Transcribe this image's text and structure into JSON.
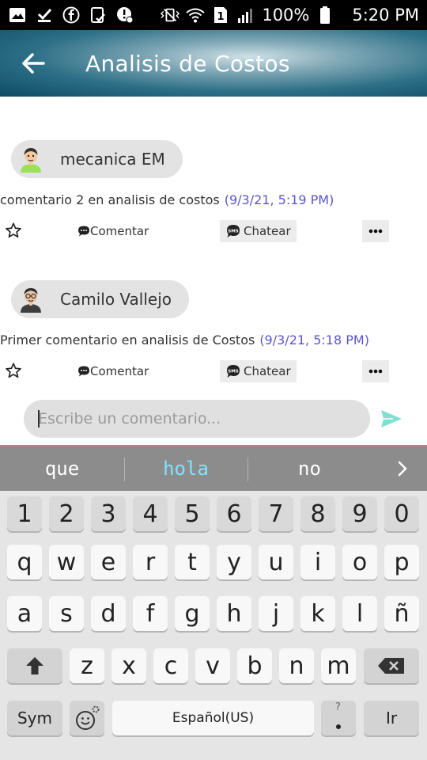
{
  "status_bar": {
    "battery": "100%",
    "time": "5:20 PM",
    "icons": [
      "image-icon",
      "download-done-icon",
      "facebook-icon",
      "clipboard-check-icon",
      "location-alert-icon",
      "vibrate-icon",
      "wifi-icon",
      "sim-1-icon",
      "signal-icon",
      "battery-icon"
    ]
  },
  "header": {
    "title": "Analisis de Costos",
    "back_icon": "arrow-left-icon",
    "background": "#1d5f78"
  },
  "comments": [
    {
      "author": "mecanica EM",
      "text": "comentario 2 en analisis de costos",
      "time": "(9/3/21, 5:19 PM)",
      "comment_label": "Comentar",
      "chat_label": "Chatear"
    },
    {
      "author": "Camilo Vallejo",
      "text": "Primer comentario en analisis de Costos",
      "time": "(9/3/21, 5:18 PM)",
      "comment_label": "Comentar",
      "chat_label": "Chatear"
    }
  ],
  "composer": {
    "placeholder": "Escribe un comentario...",
    "send_icon": "send-icon",
    "accent": "#7fe0d0"
  },
  "keyboard": {
    "suggestions": [
      "que",
      "hola",
      "no"
    ],
    "rows": [
      [
        "1",
        "2",
        "3",
        "4",
        "5",
        "6",
        "7",
        "8",
        "9",
        "0"
      ],
      [
        "q",
        "w",
        "e",
        "r",
        "t",
        "y",
        "u",
        "i",
        "o",
        "p"
      ],
      [
        "a",
        "s",
        "d",
        "f",
        "g",
        "h",
        "j",
        "k",
        "l",
        "ñ"
      ],
      [
        "z",
        "x",
        "c",
        "v",
        "b",
        "n",
        "m"
      ]
    ],
    "sym_label": "Sym",
    "space_label": "Español(US)",
    "go_label": "Ir",
    "punct_label": "?"
  }
}
